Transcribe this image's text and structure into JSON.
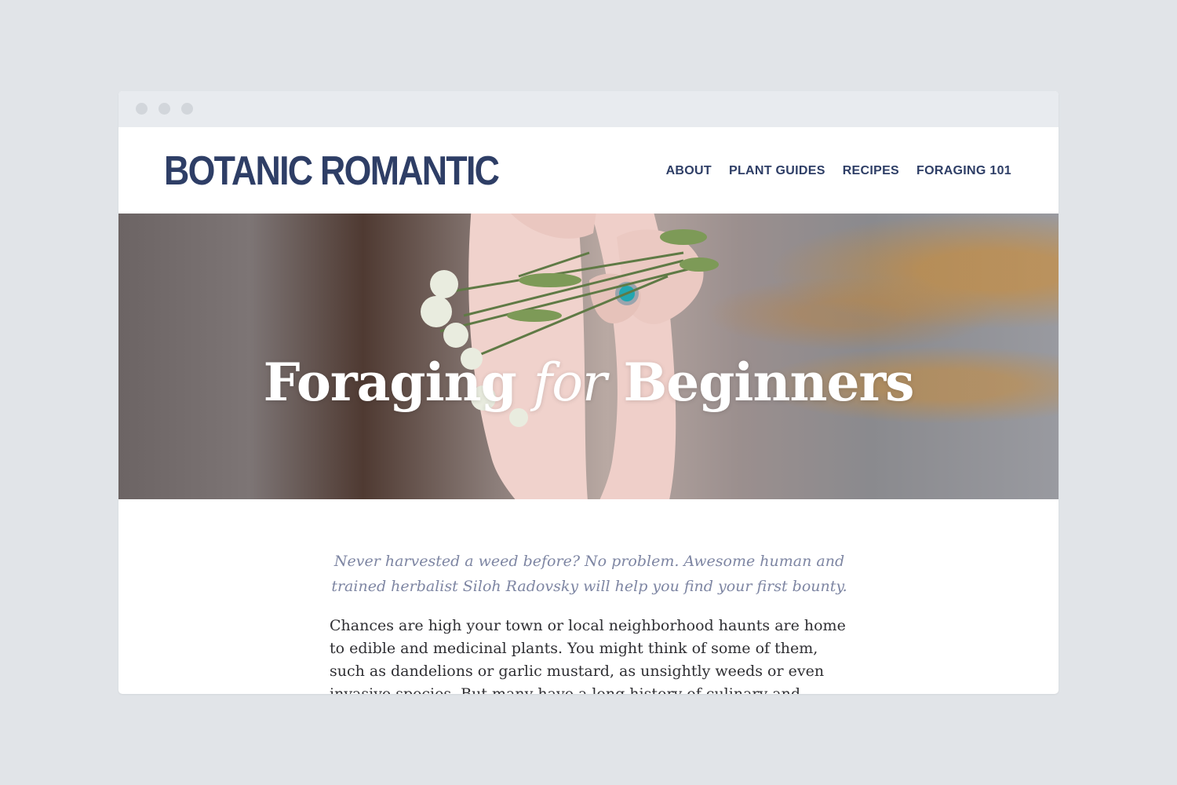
{
  "site": {
    "logo": "BOTANIC ROMANTIC",
    "nav": [
      "ABOUT",
      "PLANT GUIDES",
      "RECIPES",
      "FORAGING 101"
    ]
  },
  "hero": {
    "title_part1": "Foraging",
    "title_em": "for",
    "title_part2": "Beginners"
  },
  "article": {
    "dek": "Never harvested a weed before? No problem. Awesome human and trained herbalist Siloh Radovsky will help you find your first bounty.",
    "body": "Chances are high your town or local neighborhood haunts are home to edible and medicinal plants. You might think of some of them, such as dandelions or garlic mustard, as unsightly weeds or even invasive species. But many have a long history of culinary and medicinal use —"
  },
  "colors": {
    "brand": "#2e3e66",
    "dek": "#7e86a3",
    "page_bg": "#e1e4e8"
  }
}
